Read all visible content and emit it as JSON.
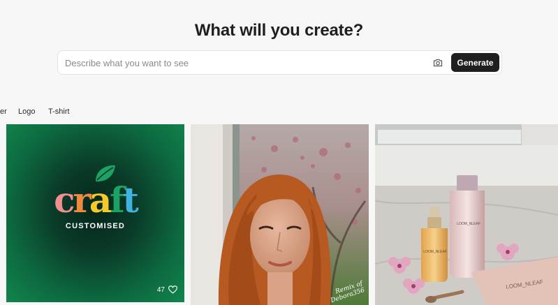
{
  "hero": {
    "title": "What will you create?"
  },
  "search": {
    "placeholder": "Describe what you want to see",
    "value": "",
    "camera_icon": "camera-icon",
    "generate_label": "Generate"
  },
  "categories": {
    "partial_left": "er",
    "items": [
      "Logo",
      "T-shirt"
    ]
  },
  "gallery": {
    "cards": [
      {
        "kind": "logo",
        "logo": {
          "letters": [
            "c",
            "r",
            "a",
            "f",
            "t"
          ],
          "colors": [
            "#ef8f8f",
            "#ee8a3d",
            "#f6c92b",
            "#1aa365",
            "#3fb2e0"
          ],
          "leaf_color": "#1aa365",
          "subtitle": "CUSTOMISED"
        },
        "likes": "47",
        "like_icon": "heart-icon"
      },
      {
        "kind": "photo",
        "description_icon": "portrait-photo",
        "signature": "Remix of Debora356"
      },
      {
        "kind": "photo",
        "description_icon": "product-photo",
        "labels": [
          "LOOM_NLEAF",
          "LOOM_NLEAF",
          "LOOM_NLEAF"
        ]
      }
    ]
  },
  "colors": {
    "background": "#f7f7f7",
    "button_bg": "#1f1f1f",
    "button_text": "#ffffff"
  }
}
